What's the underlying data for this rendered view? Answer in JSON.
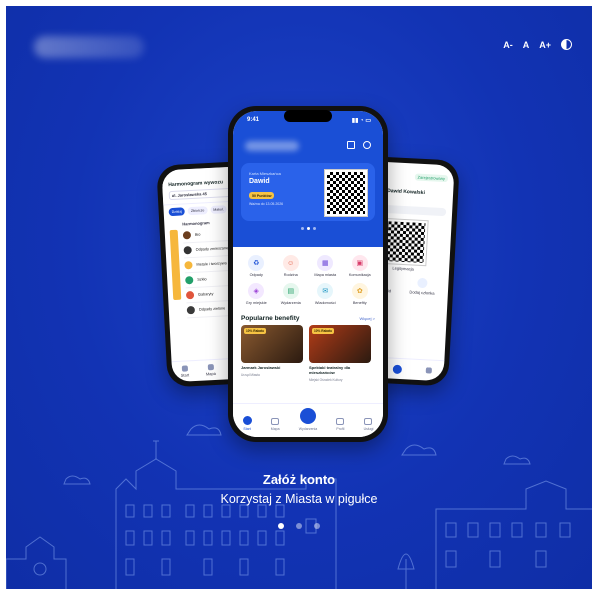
{
  "accessibility": {
    "font_decrease": "A-",
    "font_normal": "A",
    "font_increase": "A+"
  },
  "onboarding": {
    "title": "Załóż konto",
    "subtitle": "Korzystaj z Miasta w pigułce",
    "pages_total": 3,
    "active_page": 1
  },
  "center_phone": {
    "time": "9:41",
    "card": {
      "label": "Karta Mieszkańca",
      "name": "Dawid",
      "badge": "50 Punktów",
      "valid": "Ważna do 13.05.2026"
    },
    "grid": [
      {
        "label": "Odpady",
        "icon": "trash-icon",
        "color": "#e9f0ff",
        "fg": "#1a4fd6",
        "glyph": "♻"
      },
      {
        "label": "Rodzina",
        "icon": "family-icon",
        "color": "#ffeae6",
        "fg": "#e0553c",
        "glyph": "☺"
      },
      {
        "label": "Mapa miasta",
        "icon": "map-icon",
        "color": "#efe9ff",
        "fg": "#6a45d8",
        "glyph": "▦"
      },
      {
        "label": "Komunikacja",
        "icon": "bus-icon",
        "color": "#ffe7ee",
        "fg": "#d83a68",
        "glyph": "▣"
      },
      {
        "label": "Gry miejskie",
        "icon": "game-icon",
        "color": "#f3e8ff",
        "fg": "#9b3fd6",
        "glyph": "◈"
      },
      {
        "label": "Wydarzenia",
        "icon": "calendar-icon",
        "color": "#e6f7ee",
        "fg": "#23a06a",
        "glyph": "▤"
      },
      {
        "label": "Wiadomości",
        "icon": "news-icon",
        "color": "#e6f6fb",
        "fg": "#1b95c2",
        "glyph": "✉"
      },
      {
        "label": "Benefity",
        "icon": "gift-icon",
        "color": "#fff5df",
        "fg": "#e0a22c",
        "glyph": "✿"
      }
    ],
    "section_title": "Popularne benefity",
    "section_more": "Więcej  >",
    "benefits": [
      {
        "tag": "10% Rabatu",
        "title": "Jarmark Jarosławski",
        "sub": "Urząd Miasta",
        "color": "#8a5a30"
      },
      {
        "tag": "10% Rabatu",
        "title": "Spektakl teatralny dla mieszkańców",
        "sub": "Miejski Ośrodek Kultury",
        "color": "#b23c18"
      }
    ],
    "nav": [
      {
        "label": "Start",
        "icon": "home-icon",
        "active": true
      },
      {
        "label": "Mapa",
        "icon": "map-icon"
      },
      {
        "label": "Wydarzenia",
        "icon": "plus-icon",
        "fab": true
      },
      {
        "label": "Profil",
        "icon": "profile-icon"
      },
      {
        "label": "Usługi",
        "icon": "building-icon"
      }
    ]
  },
  "left_phone": {
    "time": "9:41",
    "title": "Harmonogram wywozu",
    "address": "ul. Jarosławska 45",
    "tabs": [
      "Dzisiaj",
      "Zbiorcze",
      "Makul."
    ],
    "heading": "Harmonogram",
    "items": [
      "Bio",
      "Odpady zmieszane",
      "Metale i tworzywa",
      "Szkło",
      "Gabaryty",
      "Odpady zielone"
    ],
    "item_colors": [
      "#6b3e1e",
      "#333333",
      "#f6b73c",
      "#23a06a",
      "#e0553c",
      "#3a3a3a"
    ],
    "nav": [
      "Start",
      "Mapa",
      "Wydarzenia"
    ]
  },
  "right_phone": {
    "status_chip": "Zarejestrowany",
    "name": "Dawid Kowalski",
    "caption": "Legitymacja",
    "actions": [
      "Karta Dawid",
      "Dodaj członka"
    ]
  }
}
